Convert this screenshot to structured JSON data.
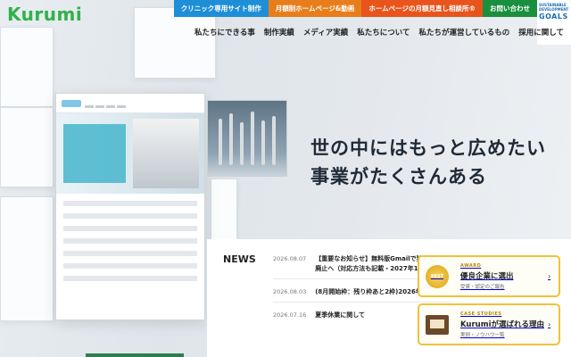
{
  "brand": {
    "logo_text": "Kurumi",
    "accent": "#2fb24a"
  },
  "top_nav": [
    {
      "label": "クリニック専用サイト制作",
      "color": "#1e8fd6"
    },
    {
      "label": "月額制ホームページ&動画",
      "color": "#e87e1b"
    },
    {
      "label": "ホームページの月額見直し相談所®",
      "color": "#e8541b"
    },
    {
      "label": "お問い合わせ",
      "color": "#1a8f3e"
    }
  ],
  "sdgs": {
    "line1": "SUSTAINABLE",
    "line2": "DEVELOPMENT",
    "line3": "GOALS"
  },
  "main_nav": [
    "私たちにできる事",
    "制作実績",
    "メディア実績",
    "私たちについて",
    "私たちが運営しているもの",
    "採用に関して"
  ],
  "hero": {
    "headline_line1": "世の中にはもっと広めたい",
    "headline_line2": "事業がたくさんある"
  },
  "news": {
    "title": "NEWS",
    "items": [
      {
        "date": "2026.08.07",
        "text": "【重要なお知らせ】無料版Gmailで独自ドメ… 廃止へ（対応方法も記載・2027年1月ま…"
      },
      {
        "date": "2026.08.03",
        "text": "(8月開始枠：残り枠あと2枠)2026年8月…"
      },
      {
        "date": "2026.07.16",
        "text": "夏季休業に関して"
      }
    ]
  },
  "cards": [
    {
      "kicker": "AWARD",
      "title": "優良企業に選出",
      "sub": "受賞・認定のご報告",
      "icon": "medal-icon",
      "medal_text": "BEST"
    },
    {
      "kicker": "CASE STUDIES",
      "title": "Kurumiが選ばれる理由",
      "sub": "実例・ノウハウ一覧",
      "icon": "book-icon"
    }
  ]
}
